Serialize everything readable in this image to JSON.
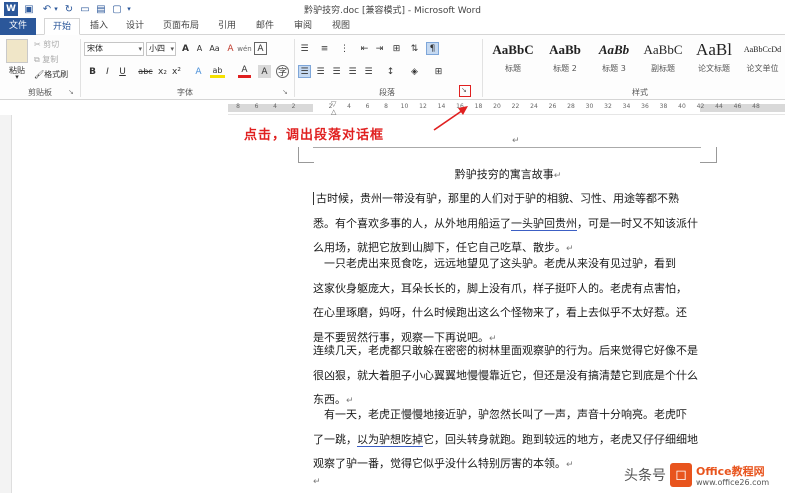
{
  "window": {
    "title": "黔驴技穷.doc [兼容模式] - Microsoft Word"
  },
  "tabs": [
    {
      "label": "文件"
    },
    {
      "label": "开始"
    },
    {
      "label": "插入"
    },
    {
      "label": "设计"
    },
    {
      "label": "页面布局"
    },
    {
      "label": "引用"
    },
    {
      "label": "邮件"
    },
    {
      "label": "审阅"
    },
    {
      "label": "视图"
    }
  ],
  "clipboard": {
    "paste": "粘贴",
    "cut": "剪切",
    "copy": "复制",
    "format_painter": "格式刷",
    "group": "剪贴板"
  },
  "font": {
    "name": "宋体",
    "size": "小四",
    "group": "字体",
    "bold": "B",
    "italic": "I",
    "underline": "U",
    "strike": "abc",
    "sub": "x₂",
    "sup": "x²",
    "clear": "A",
    "grow": "A",
    "shrink": "A",
    "aa": "Aa",
    "phon": "wén",
    "border": "A",
    "text_effect": "A",
    "highlight": "ab",
    "font_color": "A",
    "char_shade": "A",
    "enclose": "字"
  },
  "paragraph": {
    "group": "段落"
  },
  "styles": {
    "group": "样式",
    "items": [
      {
        "sample": "AaBbC",
        "name": "标题"
      },
      {
        "sample": "AaBb",
        "name": "标题 2"
      },
      {
        "sample": "AaBb",
        "name": "标题 3"
      },
      {
        "sample": "AaBbC",
        "name": "副标题"
      },
      {
        "sample": "AaBl",
        "name": "论文标题"
      },
      {
        "sample": "AaBbCcDd",
        "name": "论文单位"
      }
    ]
  },
  "ruler": {
    "numbers": [
      "8",
      "6",
      "4",
      "2",
      "",
      "2",
      "4",
      "6",
      "8",
      "10",
      "12",
      "14",
      "16",
      "18",
      "20",
      "22",
      "24",
      "26",
      "28",
      "30",
      "32",
      "34",
      "36",
      "38",
      "40",
      "42",
      "44",
      "46",
      "48"
    ]
  },
  "annotation": {
    "text": "点击，调出段落对话框",
    "color": "#e02020"
  },
  "document": {
    "title": "黔驴技穷的寓言故事",
    "paragraphs": [
      {
        "lines": [
          "古时候，贵州一带没有驴，那里的人们对于驴的相貌、习性、用途等都不熟",
          "悉。有个喜欢多事的人，从外地用船运了",
          "一头驴回贵州",
          "，可是一时又不知该派什",
          "么用场，就把它放到山脚下，任它自己吃草、散步。"
        ]
      },
      {
        "lines": [
          "　一只老虎出来觅食吃，远远地望见了这头驴。老虎从来没有见过驴，看到",
          "这家伙身躯庞大，耳朵长长的，脚上没有爪，样子挺吓人的。老虎有点害怕，",
          "在心里琢磨，妈呀，什么时候跑出这么个怪物来了，看上去似乎不太好惹。还",
          "是不要贸然行事，观察一下再说吧。"
        ]
      },
      {
        "lines": [
          "连续几天，老虎都只敢躲在密密的树林里面观察驴的行为。后来觉得它好像不是",
          "很凶狠，就大着胆子小心翼翼地慢慢靠近它，但还是没有搞清楚它到底是个什么",
          "东西。"
        ]
      },
      {
        "lines": [
          "　有一天，老虎正慢慢地接近驴，驴忽然长叫了一声，声音十分响亮。老虎吓",
          "了一跳，",
          "以为驴想吃掉",
          "它，回头转身就跑。跑到较远的地方，老虎又仔仔细细地",
          "观察了驴一番，觉得它似乎没什么特别厉害的本领。"
        ]
      }
    ],
    "para_mark": "↵"
  },
  "watermark": {
    "left_text": "头条号",
    "brand": "Office教程网",
    "url": "www.office26.com"
  }
}
